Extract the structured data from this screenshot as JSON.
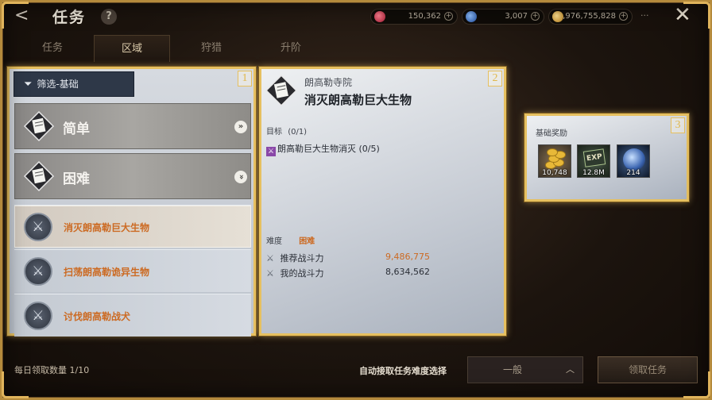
{
  "header": {
    "title": "任务",
    "help_glyph": "?",
    "back_glyph": "<",
    "menu_glyph": "···",
    "close_glyph": "✕",
    "currencies": [
      {
        "name": "red-gem-icon",
        "value": "150,362",
        "color": "#c03048"
      },
      {
        "name": "blue-gem-icon",
        "value": "3,007",
        "color": "#3a70c0"
      },
      {
        "name": "gold-coin-icon",
        "value": "9,976,755,828",
        "color": "#d8a83a"
      }
    ]
  },
  "tabs": [
    {
      "label": "任务",
      "active": false
    },
    {
      "label": "区域",
      "active": true
    },
    {
      "label": "狩猎",
      "active": false
    },
    {
      "label": "升阶",
      "active": false
    }
  ],
  "panel1": {
    "number": "1",
    "filter_label": "筛选-基础",
    "categories": [
      {
        "label": "简单",
        "arrow": "»"
      },
      {
        "label": "困难",
        "arrow": "»"
      }
    ],
    "quests": [
      {
        "label": "消灭朗高勒巨大生物",
        "selected": true
      },
      {
        "label": "扫荡朗高勒诡异生物",
        "selected": false
      },
      {
        "label": "讨伐朗高勒战犬",
        "selected": false
      }
    ]
  },
  "panel2": {
    "number": "2",
    "location": "朗高勒寺院",
    "title": "消灭朗高勒巨大生物",
    "objective_label": "目标",
    "objective_count": "(0/1)",
    "objective_item": "朗高勒巨大生物消灭 (0/5)",
    "difficulty_label": "难度",
    "difficulty_value": "困难",
    "recommended_power_label": "推荐战斗力",
    "recommended_power_value": "9,486,775",
    "my_power_label": "我的战斗力",
    "my_power_value": "8,634,562"
  },
  "panel3": {
    "number": "3",
    "reward_label": "基础奖励",
    "rewards": [
      {
        "icon": "gold-coins-icon",
        "value": "10,748"
      },
      {
        "icon": "exp-icon",
        "value": "12.8M",
        "icon_text": "EXP"
      },
      {
        "icon": "blue-orb-icon",
        "value": "214"
      }
    ]
  },
  "footer": {
    "daily_count": "每日领取数量 1/10",
    "auto_label": "自动接取任务难度选择",
    "dropdown_value": "一般",
    "dropdown_chevron": "︿",
    "claim_button": "领取任务"
  },
  "colors": {
    "gold_frame": "#e6c060",
    "orange_text": "#cc6a22",
    "purple_objective": "#8a48a8"
  }
}
